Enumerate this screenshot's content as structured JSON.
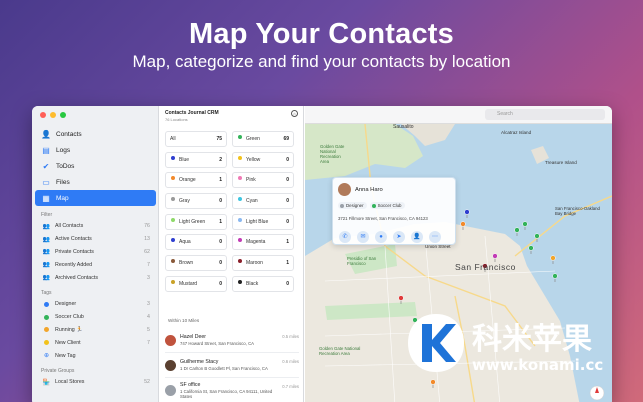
{
  "hero": {
    "title": "Map Your Contacts",
    "subtitle": "Map, categorize and find your contacts by location"
  },
  "colors": {
    "accent": "#2f7bf5",
    "window_bg": "#ffffff",
    "sidebar_bg": "#eef0f3",
    "map_bg": "#e9e6de",
    "water": "#b8d6ea",
    "park": "#cde7c6"
  },
  "sidebar": {
    "nav": [
      {
        "label": "Contacts",
        "icon": "person-icon",
        "glyph": "👤",
        "active": false
      },
      {
        "label": "Logs",
        "icon": "logs-icon",
        "glyph": "▤",
        "active": false
      },
      {
        "label": "ToDos",
        "icon": "checkmark-circle-icon",
        "glyph": "✔",
        "active": false
      },
      {
        "label": "Files",
        "icon": "folder-icon",
        "glyph": "▭",
        "active": false
      },
      {
        "label": "Map",
        "icon": "map-icon",
        "glyph": "▦",
        "active": true
      }
    ],
    "filter_label": "Filter",
    "filters": [
      {
        "label": "All Contacts",
        "count": "76",
        "glyph": "👥"
      },
      {
        "label": "Active Contacts",
        "count": "13",
        "glyph": "👥"
      },
      {
        "label": "Private Contacts",
        "count": "62",
        "glyph": "👥"
      },
      {
        "label": "Recently Added",
        "count": "7",
        "glyph": "👥"
      },
      {
        "label": "Archived Contacts",
        "count": "3",
        "glyph": "👥"
      }
    ],
    "tags_label": "Tags",
    "tags": [
      {
        "label": "Designer",
        "count": "3",
        "color": "#2f7bf5"
      },
      {
        "label": "Soccer Club",
        "count": "4",
        "color": "#33b35a"
      },
      {
        "label": "Running 🏃",
        "count": "5",
        "color": "#f2a52b"
      },
      {
        "label": "New Client",
        "count": "7",
        "color": "#f2c21b"
      },
      {
        "label": "New Tag",
        "count": "",
        "color": "add"
      }
    ],
    "groups_label": "Private Groups",
    "groups": [
      {
        "label": "Local Stores",
        "count": "52",
        "glyph": "🏪"
      }
    ]
  },
  "middle": {
    "title": "Contacts Journal CRM",
    "subtitle": "76 Locations",
    "pins": [
      {
        "label": "All",
        "count": "75",
        "color": ""
      },
      {
        "label": "Green",
        "count": "69",
        "color": "#33b35a"
      },
      {
        "label": "Blue",
        "count": "2",
        "color": "#2f3fd0"
      },
      {
        "label": "Yellow",
        "count": "0",
        "color": "#f2c21b"
      },
      {
        "label": "Orange",
        "count": "1",
        "color": "#f28a2b"
      },
      {
        "label": "Pink",
        "count": "0",
        "color": "#f07ab5"
      },
      {
        "label": "Gray",
        "count": "0",
        "color": "#9a9a9a"
      },
      {
        "label": "Cyan",
        "count": "0",
        "color": "#3ec5e0"
      },
      {
        "label": "Light Green",
        "count": "1",
        "color": "#8fd96a"
      },
      {
        "label": "Light Blue",
        "count": "0",
        "color": "#8ab8f0"
      },
      {
        "label": "Aqua",
        "count": "0",
        "color": "#2f3fd0"
      },
      {
        "label": "Magenta",
        "count": "1",
        "color": "#c23bb5"
      },
      {
        "label": "Brown",
        "count": "0",
        "color": "#8a5a3a"
      },
      {
        "label": "Maroon",
        "count": "1",
        "color": "#8a1f2a"
      },
      {
        "label": "Mustard",
        "count": "0",
        "color": "#c9a227"
      },
      {
        "label": "Black",
        "count": "0",
        "color": "#222222"
      }
    ],
    "nearby_label": "Within 10 Miles",
    "nearby": [
      {
        "name": "Hazel Deer",
        "address": "747 Howard Street, San Francisco, CA",
        "distance": "0.5 miles",
        "avatar": "#c0533d"
      },
      {
        "name": "Guilherme Stacy",
        "address": "1 Dr Carlton B Goodlett Pl, San Francisco, CA",
        "distance": "0.6 miles",
        "avatar": "#5a4030"
      },
      {
        "name": "SF office",
        "address": "1 California St, San Francisco, CA 94111, United States",
        "distance": "0.7 miles",
        "avatar": "#9aa0a8"
      }
    ]
  },
  "map": {
    "search_placeholder": "Search",
    "popup": {
      "name": "Anna Haro",
      "tags": [
        {
          "label": "Designer",
          "color": "#9aa0a8"
        },
        {
          "label": "Soccer Club",
          "color": "#33b35a"
        }
      ],
      "address": "3721 Fillmore Street, San Francisco, CA 94123",
      "actions": [
        "phone-icon",
        "mail-icon",
        "message-icon",
        "directions-icon",
        "contact-icon",
        "more-icon"
      ]
    },
    "labels": {
      "sausalito": "Sausalito",
      "presidio": "Presidio of San Francisco",
      "union_street": "Union Street",
      "sf": "San Francisco",
      "alcatraz": "Alcatraz Island",
      "treasure": "Treasure Island",
      "bay_bridge": "San Francisco-Oakland Bay Bridge",
      "golden_gate": "Golden Gate National Recreation Area",
      "golden_gate_2": "Golden Gate National Recreation Area"
    },
    "pins": [
      {
        "color": "#2f3fd0"
      },
      {
        "color": "#33b35a"
      },
      {
        "color": "#33b35a"
      },
      {
        "color": "#33b35a"
      },
      {
        "color": "#33b35a"
      },
      {
        "color": "#f2a52b"
      },
      {
        "color": "#8a1f2a"
      },
      {
        "color": "#c23bb5"
      },
      {
        "color": "#f28a2b"
      },
      {
        "color": "#e03a3a"
      },
      {
        "color": "#2f3fd0"
      },
      {
        "color": "#33b35a"
      },
      {
        "color": "#33b35a"
      },
      {
        "color": "#e03a3a"
      },
      {
        "color": "#f28a2b"
      },
      {
        "color": "#33b35a"
      }
    ]
  },
  "watermark": {
    "cn": "科米苹果",
    "url": "www.konami.cc"
  }
}
